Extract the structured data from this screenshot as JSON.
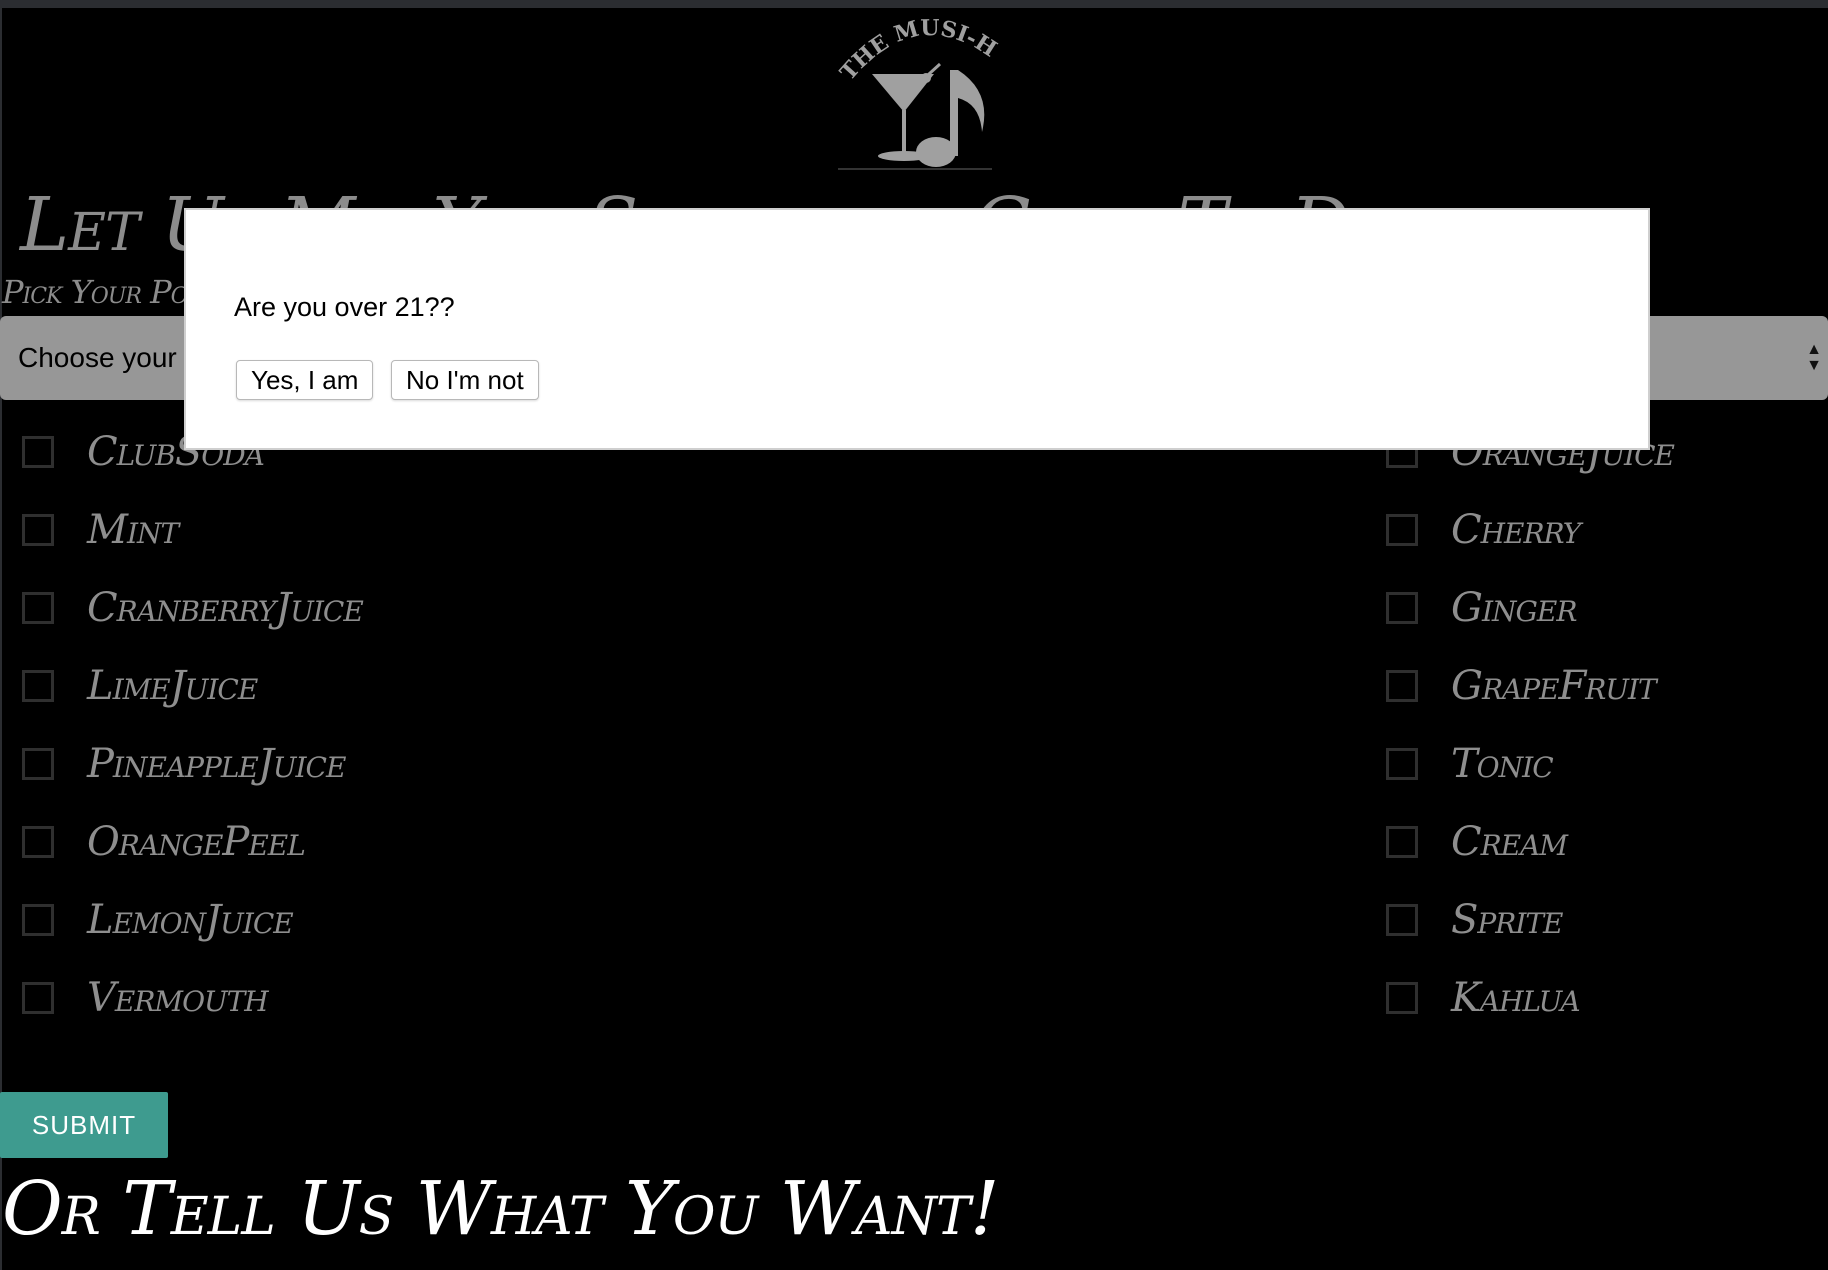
{
  "logo": {
    "text": "THE MUSI-HOLIC"
  },
  "headline": "Let Us Mix You Something Good To Drink",
  "subhead": "Pick Your Poison",
  "select": {
    "value": "Choose your"
  },
  "ingredients_left": [
    "ClubSoda",
    "Mint",
    "CranberryJuice",
    "LimeJuice",
    "PineappleJuice",
    "OrangePeel",
    "LemonJuice",
    "Vermouth"
  ],
  "ingredients_right": [
    "OrangeJuice",
    "Cherry",
    "Ginger",
    "GrapeFruit",
    "Tonic",
    "Cream",
    "Sprite",
    "Kahlua"
  ],
  "submit_label": "SUBMIT",
  "footer_title": "Or Tell Us What You Want!",
  "modal": {
    "question": "Are you over 21??",
    "yes_label": "Yes, I am",
    "no_label": "No I'm not"
  },
  "colors": {
    "accent": "#3e9b8f",
    "background": "#000000"
  }
}
